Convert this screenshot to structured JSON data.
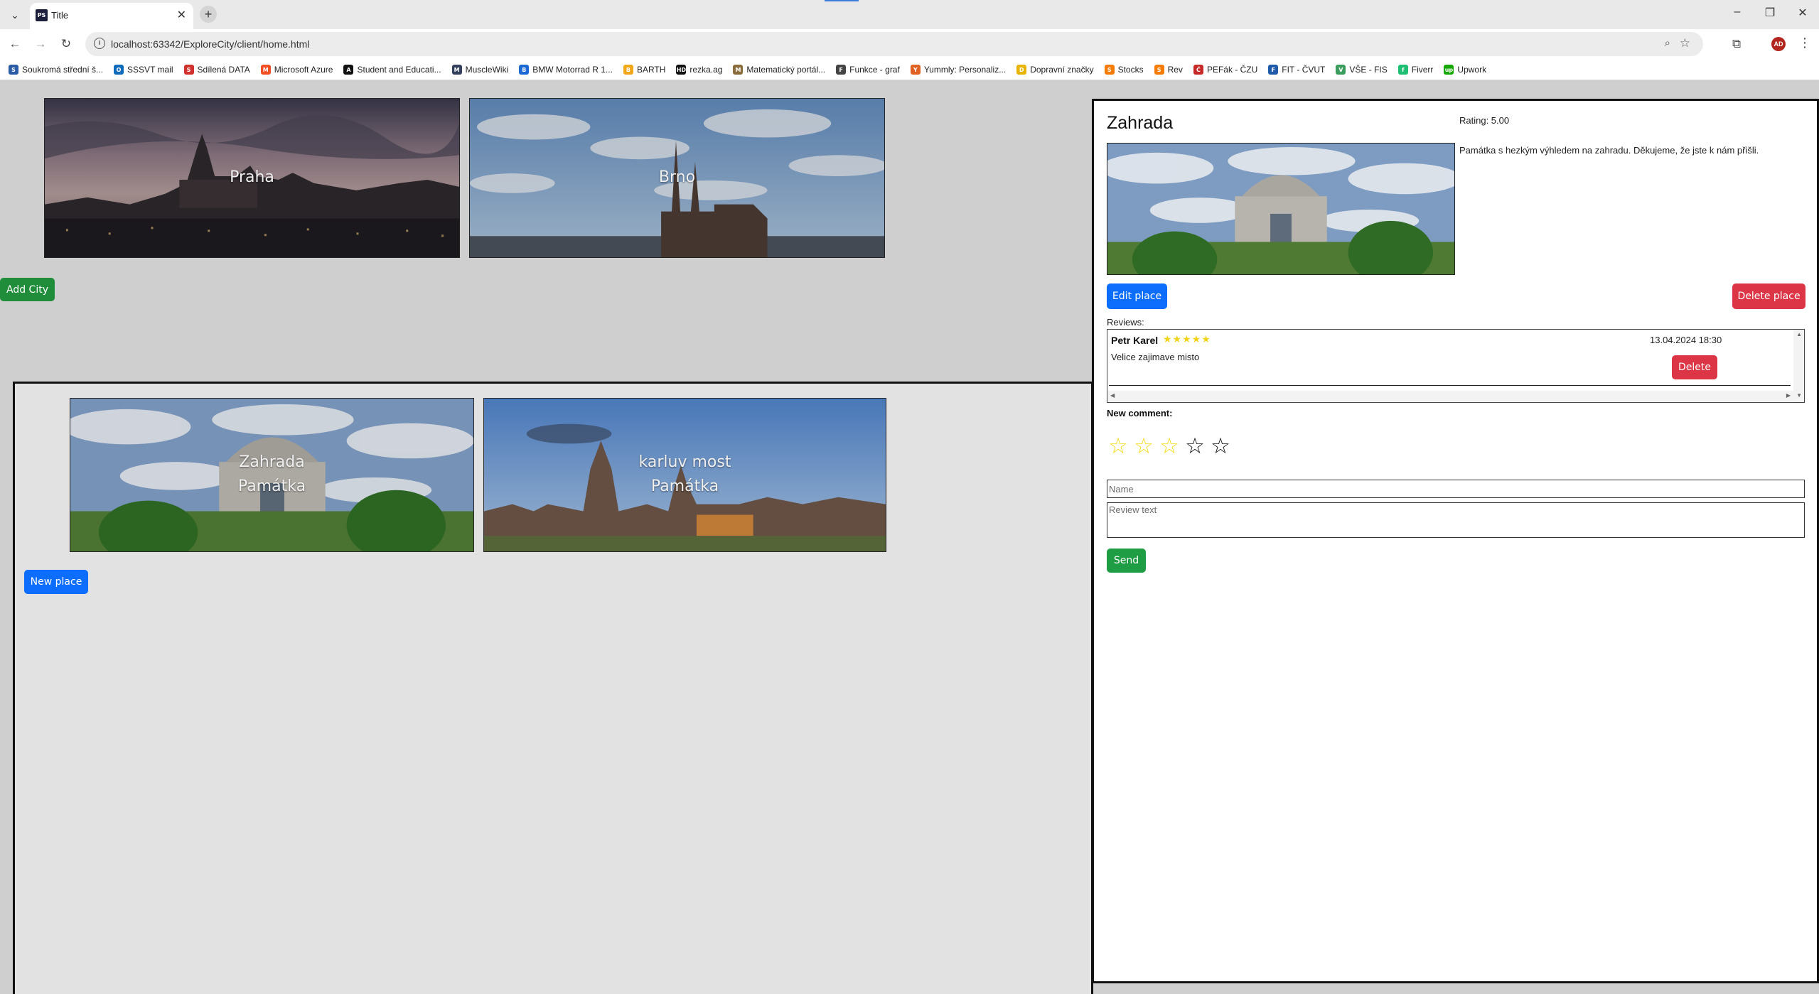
{
  "browser": {
    "tab_title": "Title",
    "favicon_text": "PS",
    "url": "localhost:63342/ExploreCity/client/home.html",
    "profile_initials": "AD",
    "bookmarks": [
      {
        "label": "Soukromá střední š...",
        "color": "#2b5aa6"
      },
      {
        "label": "SSSVT mail",
        "color": "#0f6cbd"
      },
      {
        "label": "Sdílená DATA",
        "color": "#d0312d"
      },
      {
        "label": "Microsoft Azure",
        "color": "#f25022"
      },
      {
        "label": "Student and Educati...",
        "color": "#111111"
      },
      {
        "label": "MuscleWiki",
        "color": "#33415c"
      },
      {
        "label": "BMW Motorrad R 1...",
        "color": "#1c69d4"
      },
      {
        "label": "BARTH",
        "color": "#f0a818"
      },
      {
        "label": "rezka.ag",
        "color": "#111111"
      },
      {
        "label": "Matematický portál...",
        "color": "#8a6d3b"
      },
      {
        "label": "Funkce - graf",
        "color": "#444444"
      },
      {
        "label": "Yummly: Personaliz...",
        "color": "#e16120"
      },
      {
        "label": "Dopravní značky",
        "color": "#e8b400"
      },
      {
        "label": "Stocks",
        "color": "#f57c00"
      },
      {
        "label": "Rev",
        "color": "#f57c00"
      },
      {
        "label": "PEFák - ČZU",
        "color": "#c62828"
      },
      {
        "label": "FIT - ČVUT",
        "color": "#1e5aa8"
      },
      {
        "label": "VŠE - FIS",
        "color": "#3a9d5d"
      },
      {
        "label": "Fiverr",
        "color": "#1dbf73"
      },
      {
        "label": "Upwork",
        "color": "#14a800"
      }
    ],
    "bookmark_glyphs": [
      "S",
      "O",
      "S",
      "M",
      "A",
      "M",
      "B",
      "B",
      "HD",
      "M",
      "F",
      "Y",
      "D",
      "S",
      "S",
      "Č",
      "F",
      "V",
      "f",
      "up"
    ]
  },
  "cities": [
    {
      "name": "Praha"
    },
    {
      "name": "Brno"
    }
  ],
  "add_city_label": "Add City",
  "places": [
    {
      "name": "Zahrada",
      "type": "Památka"
    },
    {
      "name": "karluv most",
      "type": "Památka"
    }
  ],
  "new_place_label": "New place",
  "detail": {
    "title": "Zahrada",
    "rating_text": "Rating: 5.00",
    "description": "Památka s hezkým výhledem na zahradu. Děkujeme, že jste k nám přišli.",
    "edit_label": "Edit place",
    "delete_label": "Delete place",
    "reviews_label": "Reviews:",
    "reviews": [
      {
        "author": "Petr Karel",
        "stars": 5,
        "stars_text": "★★★★★",
        "date": "13.04.2024 18:30",
        "text": "Velice zajimave misto",
        "delete_label": "Delete"
      }
    ],
    "new_comment_label": "New comment:",
    "new_comment_rating": 3,
    "new_comment_max": 5,
    "name_placeholder": "Name",
    "review_placeholder": "Review text",
    "send_label": "Send"
  },
  "colors": {
    "primary": "#0d6efd",
    "success": "#1f9d44",
    "danger": "#dc3545",
    "star": "#f4dc1a"
  }
}
